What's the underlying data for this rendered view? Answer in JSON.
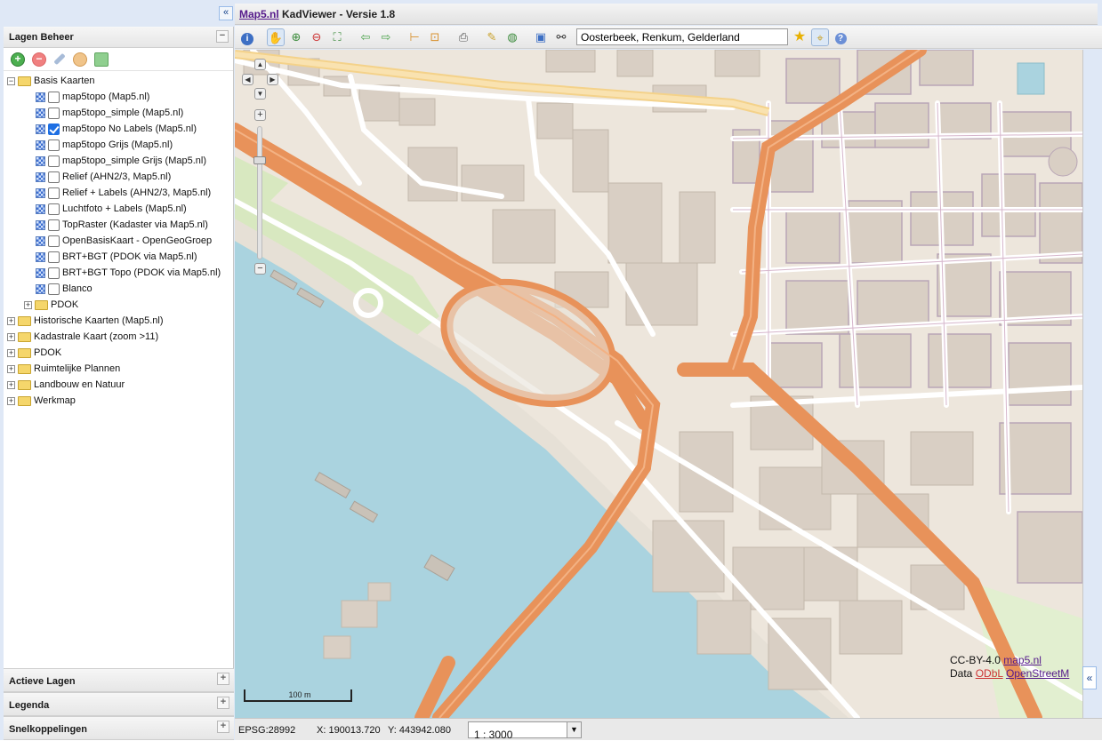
{
  "header": {
    "collapse_icon": "double-chevron-left-icon",
    "title_link": "Map5.nl",
    "title_rest": " KadViewer - Versie 1.8"
  },
  "layers_panel": {
    "title": "Lagen Beheer",
    "toolbar_icons": [
      "add-icon",
      "remove-icon",
      "wrench-icon",
      "layer-style-icon",
      "layer-group-icon"
    ],
    "tree": {
      "basis_label": "Basis Kaarten",
      "basis_layers": [
        {
          "label": "map5topo (Map5.nl)",
          "checked": false
        },
        {
          "label": "map5topo_simple (Map5.nl)",
          "checked": false
        },
        {
          "label": "map5topo No Labels (Map5.nl)",
          "checked": true
        },
        {
          "label": "map5topo Grijs (Map5.nl)",
          "checked": false
        },
        {
          "label": "map5topo_simple Grijs (Map5.nl)",
          "checked": false
        },
        {
          "label": "Relief (AHN2/3, Map5.nl)",
          "checked": false
        },
        {
          "label": "Relief + Labels (AHN2/3, Map5.nl)",
          "checked": false
        },
        {
          "label": "Luchtfoto + Labels (Map5.nl)",
          "checked": false
        },
        {
          "label": "TopRaster (Kadaster via Map5.nl)",
          "checked": false
        },
        {
          "label": "OpenBasisKaart - OpenGeoGroep",
          "checked": false
        },
        {
          "label": "BRT+BGT (PDOK via Map5.nl)",
          "checked": false
        },
        {
          "label": "BRT+BGT Topo (PDOK via Map5.nl)",
          "checked": false
        },
        {
          "label": "Blanco",
          "checked": false
        }
      ],
      "basis_subfolder": "PDOK",
      "folders": [
        "Historische Kaarten (Map5.nl)",
        "Kadastrale Kaart (zoom >11)",
        "PDOK",
        "Ruimtelijke Plannen",
        "Landbouw en Natuur",
        "Werkmap"
      ]
    }
  },
  "bottom_panels": [
    "Actieve Lagen",
    "Legenda",
    "Snelkoppelingen"
  ],
  "map_toolbar": {
    "search_value": "Oosterbeek, Renkum, Gelderland"
  },
  "map": {
    "scale_label": "100 m",
    "attribution_line1_prefix": "CC-BY-4.0 ",
    "attribution_line1_link": "map5.nl",
    "attribution_line2_prefix": "Data ",
    "attribution_line2_link1": "ODbL",
    "attribution_line2_link2": "OpenStreetM"
  },
  "statusbar": {
    "epsg": "EPSG:28992",
    "x": "X: 190013.720",
    "y": "Y: 443942.080",
    "scale": "1 : 3000"
  },
  "colors": {
    "water": "#aad3df",
    "motorway": "#e8925a",
    "building": "#d9cfc4",
    "land": "#ede6dc",
    "grass": "#d8e8c0"
  }
}
